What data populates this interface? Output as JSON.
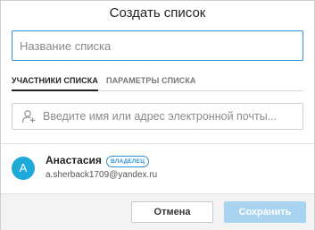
{
  "dialog": {
    "title": "Создать список"
  },
  "list_name": {
    "placeholder": "Название списка",
    "value": ""
  },
  "tabs": [
    {
      "label": "УЧАСТНИКИ СПИСКА",
      "active": true
    },
    {
      "label": "ПАРАМЕТРЫ СПИСКА",
      "active": false
    }
  ],
  "member_search": {
    "placeholder": "Введите имя или адрес электронной почты...",
    "icon": "add-user-icon"
  },
  "members": [
    {
      "avatar_letter": "А",
      "name": "Анастасия",
      "badge": "ВЛАДЕЛЕЦ",
      "email": "a.sherback1709@yandex.ru"
    }
  ],
  "footer": {
    "cancel_label": "Отмена",
    "save_label": "Сохранить"
  },
  "colors": {
    "accent": "#2f8fd6",
    "avatar": "#1eaad8",
    "save_disabled": "#a9d4f0"
  }
}
